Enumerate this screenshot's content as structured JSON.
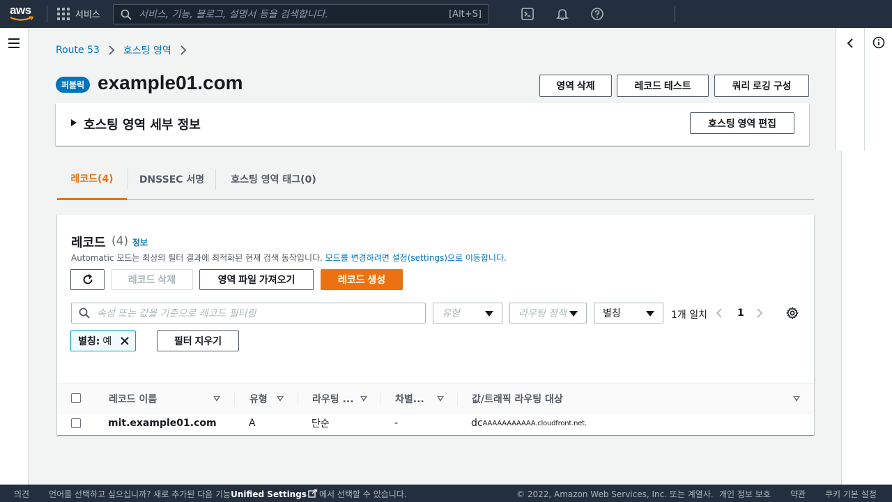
{
  "topnav": {
    "logo_text": "aws",
    "services_label": "서비스",
    "search_placeholder": "서비스, 기능, 블로그, 설명서 등을 검색합니다.",
    "search_shortcut": "[Alt+S]",
    "icons": [
      "cloudshell-icon",
      "bell-icon",
      "help-icon"
    ]
  },
  "breadcrumb": {
    "items": [
      "Route 53",
      "호스팅 영역"
    ]
  },
  "header": {
    "badge": "퍼블릭",
    "title": "example01.com",
    "buttons": {
      "delete_zone": "영역 삭제",
      "test_record": "레코드 테스트",
      "query_logging": "쿼리 로깅 구성"
    }
  },
  "details": {
    "title": "호스팅 영역 세부 정보",
    "edit_button": "호스팅 영역 편집"
  },
  "tabs": [
    {
      "label": "레코드(4)",
      "active": true
    },
    {
      "label": "DNSSEC 서명",
      "active": false
    },
    {
      "label": "호스팅 영역 태그(0)",
      "active": false
    }
  ],
  "records": {
    "title": "레코드",
    "count": "(4)",
    "info": "정보",
    "desc_prefix": "Automatic 모드는 최상의 필터 결과에 최적화된 현재 검색 동작입니다.",
    "desc_link": "모드를 변경하려면 설정(settings)으로 이동합니다.",
    "buttons": {
      "delete": "레코드 삭제",
      "import": "영역 파일 가져오기",
      "create": "레코드 생성"
    },
    "filter_placeholder": "속성 또는 값을 기준으로 레코드 필터링",
    "type_placeholder": "유형",
    "routing_placeholder": "라우팅 정책",
    "alias_value": "별칭",
    "match_text": "1개 일치",
    "page": "1",
    "token": {
      "key": "별칭:",
      "value": "예"
    },
    "clear_filter": "필터 지우기",
    "columns": [
      "레코드 이름",
      "유형",
      "라우팅 ...",
      "차별...",
      "값/트래픽 라우팅 대상"
    ],
    "rows": [
      {
        "name": "mit.example01.com",
        "type": "A",
        "routing": "단순",
        "diff": "-",
        "value_prefix": "dc",
        "value_rest": "AAAAAAAAAAA.cloudfront.net."
      }
    ]
  },
  "footer": {
    "feedback": "의견",
    "language_text": "언어를 선택하고 싶으십니까? 새로 추가된 다음 기능",
    "unified_settings": "Unified Settings",
    "language_suffix": "에서 선택할 수 있습니다.",
    "copyright": "© 2022, Amazon Web Services, Inc. 또는 계열사.",
    "privacy": "개인 정보 보호",
    "terms": "약관",
    "cookies": "쿠키 기본 설정"
  },
  "colors": {
    "nav_bg": "#232f3e",
    "accent_orange": "#ec7211",
    "link_blue": "#0073bb",
    "page_bg": "#f2f3f3"
  }
}
